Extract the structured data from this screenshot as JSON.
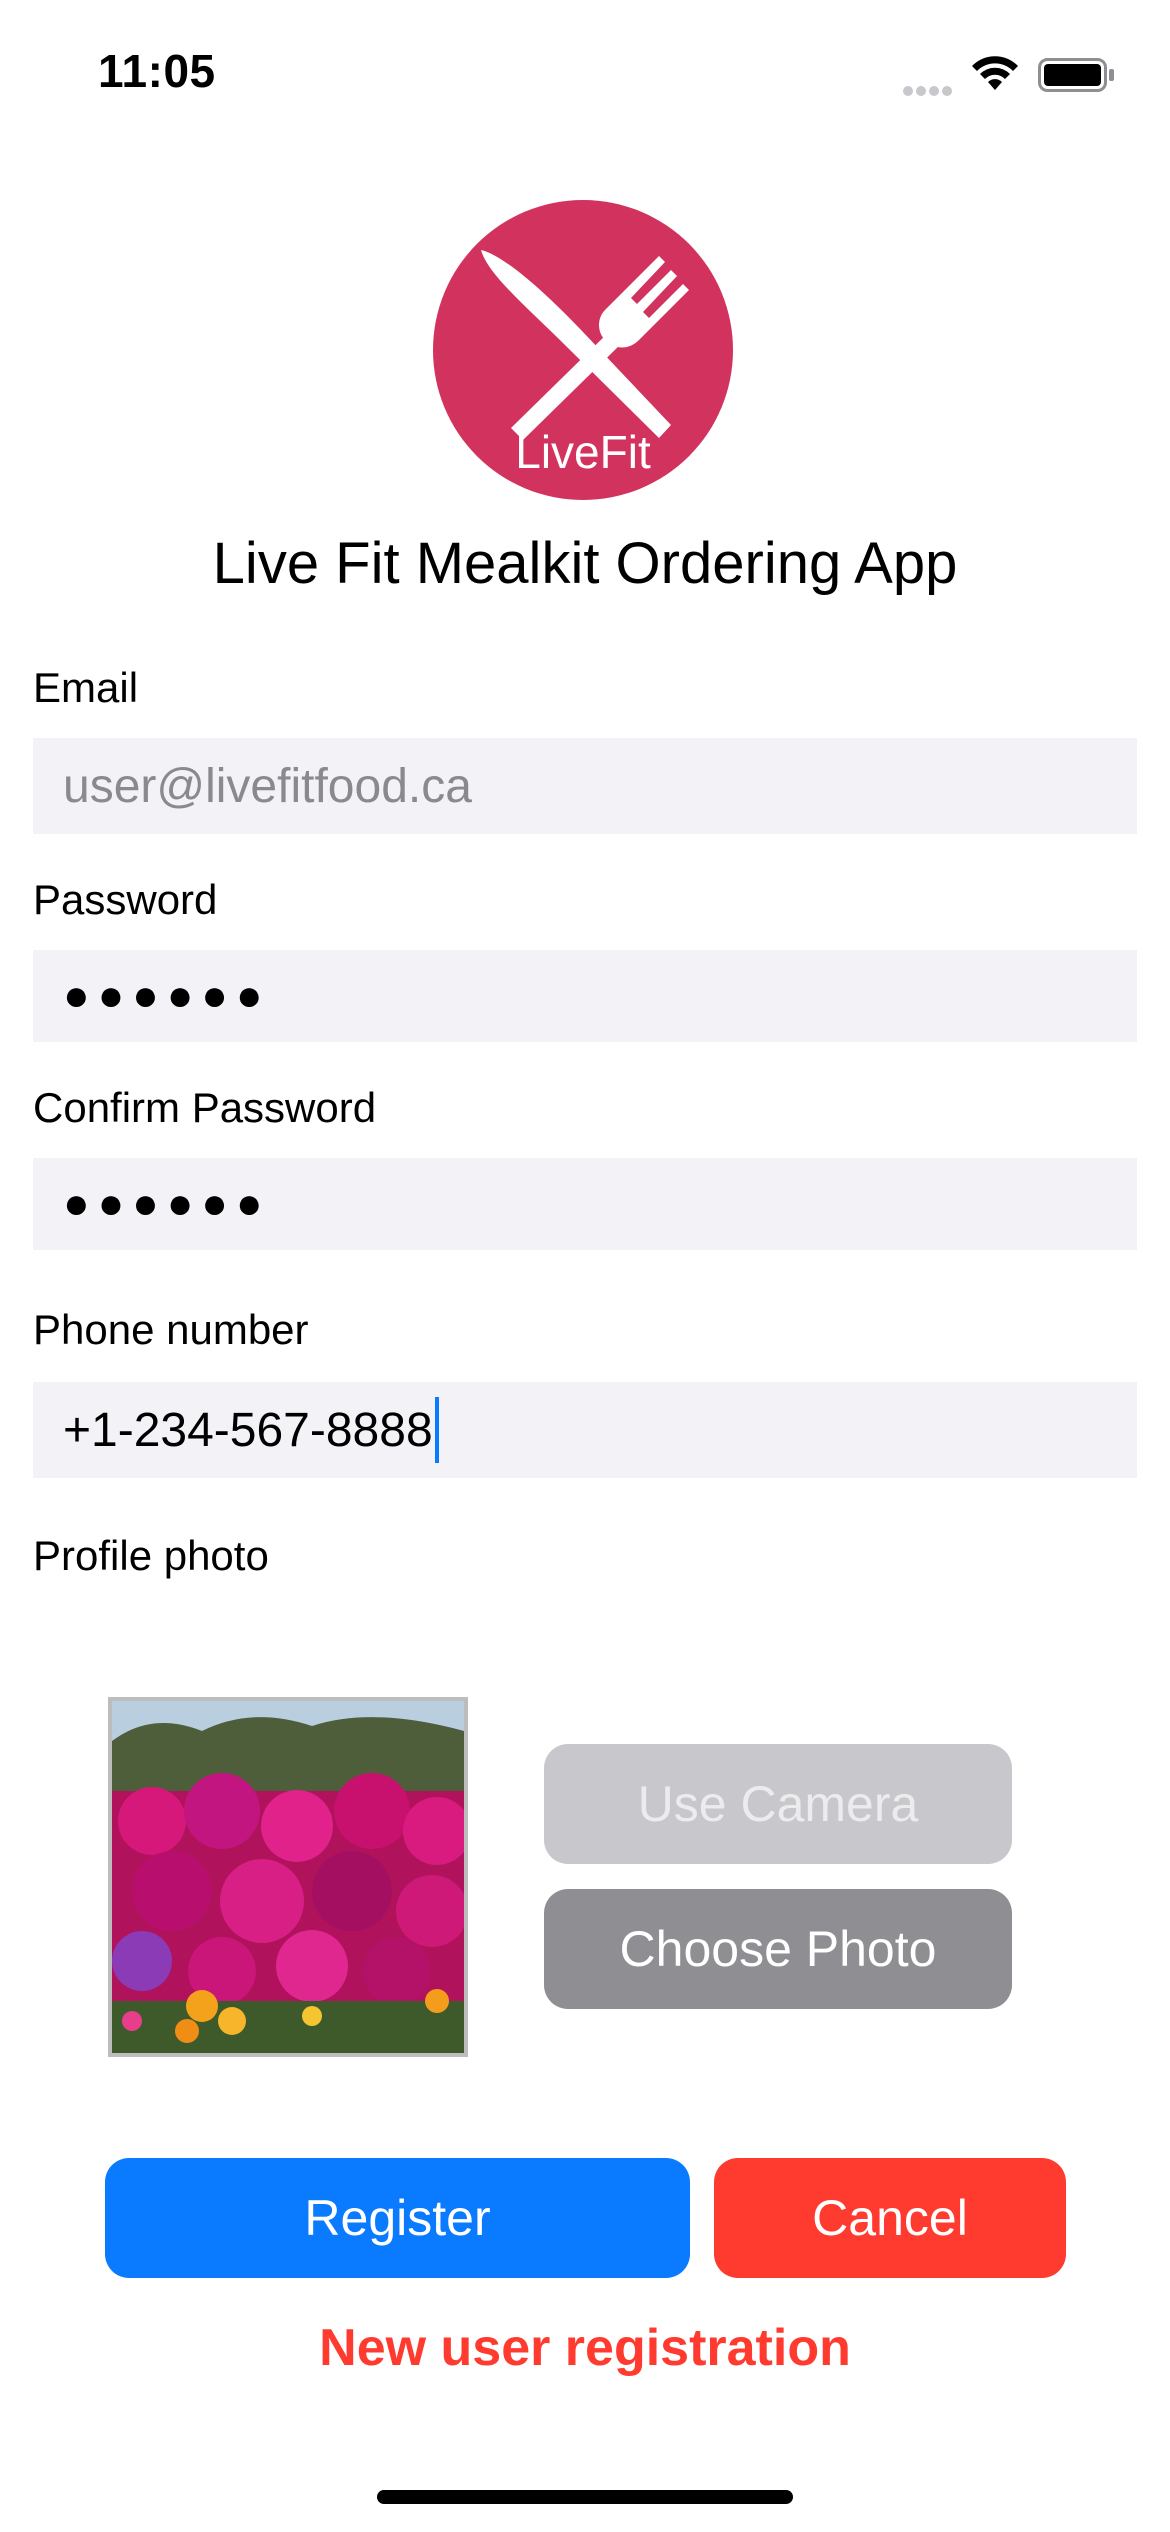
{
  "status_bar": {
    "time": "11:05"
  },
  "app": {
    "logo_text": "LiveFit",
    "title": "Live Fit Mealkit Ordering App",
    "brand_color": "#d1335e"
  },
  "form": {
    "email": {
      "label": "Email",
      "value": "",
      "placeholder": "user@livefitfood.ca"
    },
    "password": {
      "label": "Password",
      "value": "●●●●●●"
    },
    "confirm_password": {
      "label": "Confirm Password",
      "value": "●●●●●●"
    },
    "phone": {
      "label": "Phone number",
      "value": "+1-234-567-8888"
    },
    "profile_photo": {
      "label": "Profile photo"
    }
  },
  "photo_buttons": {
    "use_camera": "Use Camera",
    "choose_photo": "Choose Photo"
  },
  "actions": {
    "register": "Register",
    "cancel": "Cancel"
  },
  "message": "New user registration",
  "colors": {
    "register": "#0a7aff",
    "cancel": "#ff3b30",
    "field_bg": "#f2f2f7"
  }
}
